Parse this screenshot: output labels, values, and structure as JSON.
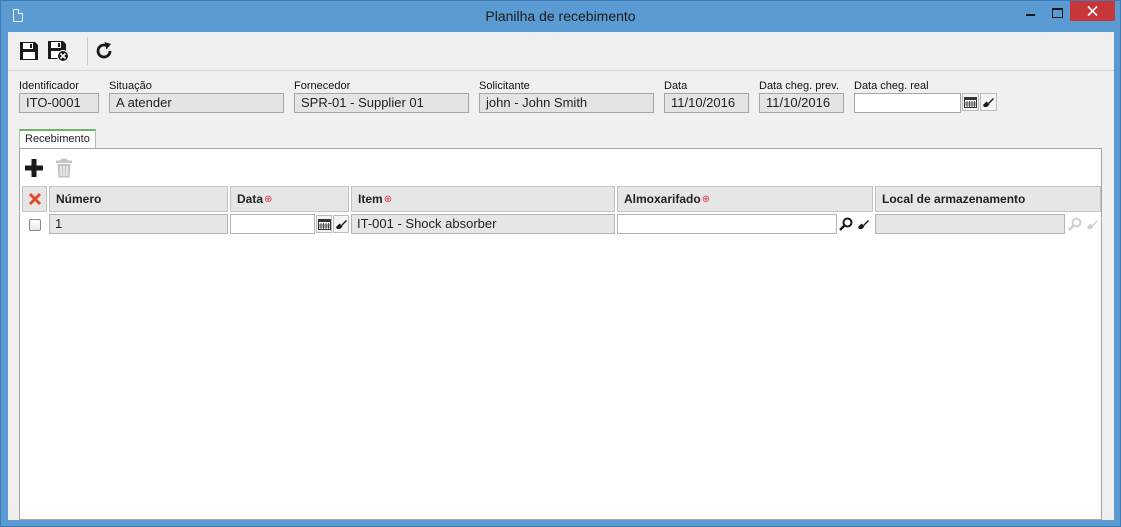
{
  "window": {
    "title": "Planilha de recebimento"
  },
  "toolbar": {
    "buttons": [
      {
        "icon": "save-icon"
      },
      {
        "icon": "save-close-icon"
      },
      {
        "icon": "refresh-icon"
      }
    ]
  },
  "form": {
    "identificador": {
      "label": "Identificador",
      "value": "ITO-0001"
    },
    "situacao": {
      "label": "Situação",
      "value": "A atender"
    },
    "fornecedor": {
      "label": "Fornecedor",
      "value": "SPR-01 - Supplier 01"
    },
    "solicitante": {
      "label": "Solicitante",
      "value": "john - John Smith"
    },
    "data": {
      "label": "Data",
      "value": "11/10/2016"
    },
    "data_cheg_prev": {
      "label": "Data cheg. prev.",
      "value": "11/10/2016"
    },
    "data_cheg_real": {
      "label": "Data cheg. real",
      "value": ""
    }
  },
  "tabs": [
    {
      "label": "Recebimento",
      "active": true
    }
  ],
  "grid": {
    "columns": [
      {
        "label": "Número",
        "required": false
      },
      {
        "label": "Data",
        "required": true
      },
      {
        "label": "Item",
        "required": true
      },
      {
        "label": "Almoxarifado",
        "required": true
      },
      {
        "label": "Local de armazenamento",
        "required": false
      }
    ],
    "required_marker": "⊕",
    "rows": [
      {
        "numero": "1",
        "data": "",
        "item": "IT-001 - Shock absorber",
        "almoxarifado": "",
        "local": ""
      }
    ]
  },
  "colors": {
    "titlebar": "#5b9bd3",
    "close_button": "#c7373a",
    "required_marker": "#d93a3a",
    "tab_accent": "#6fb36a"
  }
}
